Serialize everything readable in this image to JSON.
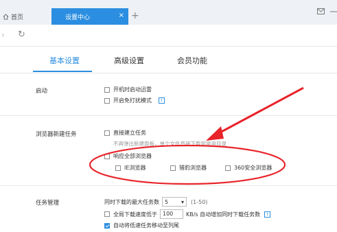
{
  "browser": {
    "home_tab_label": "首页",
    "active_tab_label": "设置中心",
    "close_glyph": "×",
    "new_tab_glyph": "+",
    "window_icons": [
      "mail-icon",
      "minimize-icon"
    ]
  },
  "settings_tabs": [
    {
      "label": "基本设置",
      "active": true
    },
    {
      "label": "高级设置",
      "active": false
    },
    {
      "label": "会员功能",
      "active": false
    }
  ],
  "startup": {
    "label": "启动",
    "options": [
      {
        "label": "开机时启动迅雷",
        "checked": false
      },
      {
        "label": "开启免打扰模式",
        "checked": false,
        "info": "i"
      }
    ]
  },
  "browser_task": {
    "label": "浏览器新建任务",
    "direct_create": {
      "label": "直接建立任务",
      "checked": false
    },
    "hint": "不再弹出新建面板，单个文件直接下载到常用目录",
    "respond_all": {
      "label": "响应全部浏览器",
      "checked": false
    },
    "browsers": [
      {
        "label": "IE浏览器",
        "checked": false
      },
      {
        "label": "猎豹浏览器",
        "checked": false
      },
      {
        "label": "360安全浏览器",
        "checked": false
      }
    ]
  },
  "task_management": {
    "label": "任务管理",
    "max_downloads_label": "同时下载的最大任务数",
    "max_downloads_value": "5",
    "max_downloads_range": "(1-50)",
    "speed_label": "全局下载速度低于",
    "speed_value": "100",
    "speed_suffix": "KB/s 自动增加同时下载任务数",
    "speed_info": "i",
    "move_slow": {
      "label": "自动将低速任务移动至列尾",
      "checked": true
    }
  },
  "annotation_color": "#e8232a",
  "accent_color": "#2b8ee0"
}
